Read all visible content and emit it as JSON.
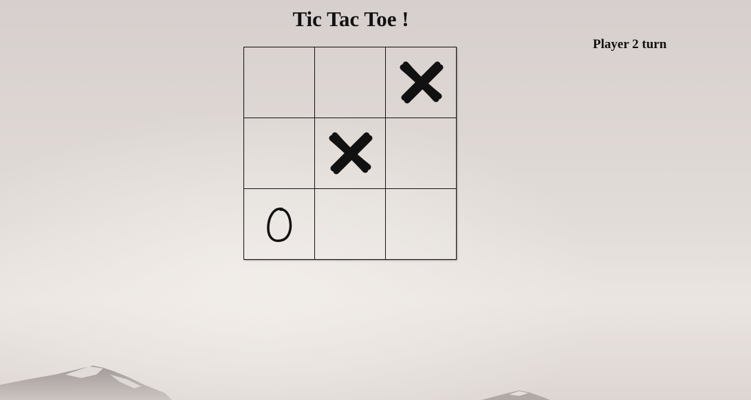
{
  "title": "Tic Tac Toe !",
  "status": "Player 2 turn",
  "board": {
    "cells": [
      "",
      "",
      "X",
      "",
      "X",
      "",
      "O",
      "",
      ""
    ]
  },
  "colors": {
    "sky_top": "#d7d0ce",
    "sky_bottom": "#ebe6e2",
    "mark": "#111111",
    "grid_line": "#111111"
  }
}
